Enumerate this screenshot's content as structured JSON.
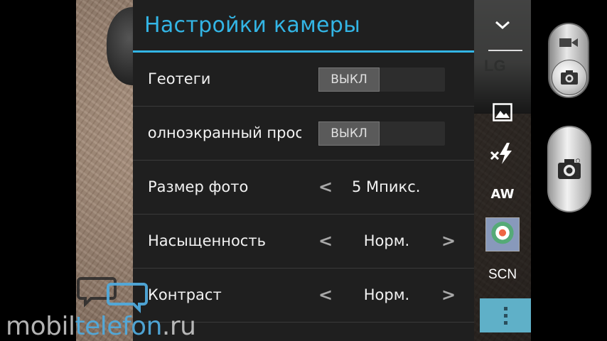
{
  "panel": {
    "title": "Настройки камеры",
    "accent_color": "#33b5e5",
    "rows": [
      {
        "label": "Геотеги",
        "type": "toggle",
        "value": "ВЫКЛ"
      },
      {
        "label": "Полноэкранный просмотр",
        "type": "toggle",
        "value": "ВЫКЛ"
      },
      {
        "label": "Размер фото",
        "type": "selector",
        "value": "5 Мпикс.",
        "has_next": false
      },
      {
        "label": "Насыщенность",
        "type": "selector",
        "value": "Норм.",
        "has_next": true
      },
      {
        "label": "Контраст",
        "type": "selector",
        "value": "Норм.",
        "has_next": true
      }
    ],
    "prev_glyph": "<",
    "next_glyph": ">"
  },
  "controls": {
    "collapse_icon": "chevron-down-icon",
    "gallery_icon": "image-icon",
    "flash_icon": "flash-off-icon",
    "white_balance": "AW",
    "scene_thumbnail_icon": "flower-thumbnail",
    "scene_label": "SCN",
    "more_icon": "overflow-menu-icon"
  },
  "background": {
    "logo_text": "LG"
  },
  "mode_switch": {
    "video_icon": "video-camera-icon",
    "photo_icon": "camera-icon"
  },
  "shutter": {
    "label": "Camera"
  },
  "watermark": {
    "part1": "mobil",
    "part2": "telefon",
    "part3": ".ru"
  }
}
